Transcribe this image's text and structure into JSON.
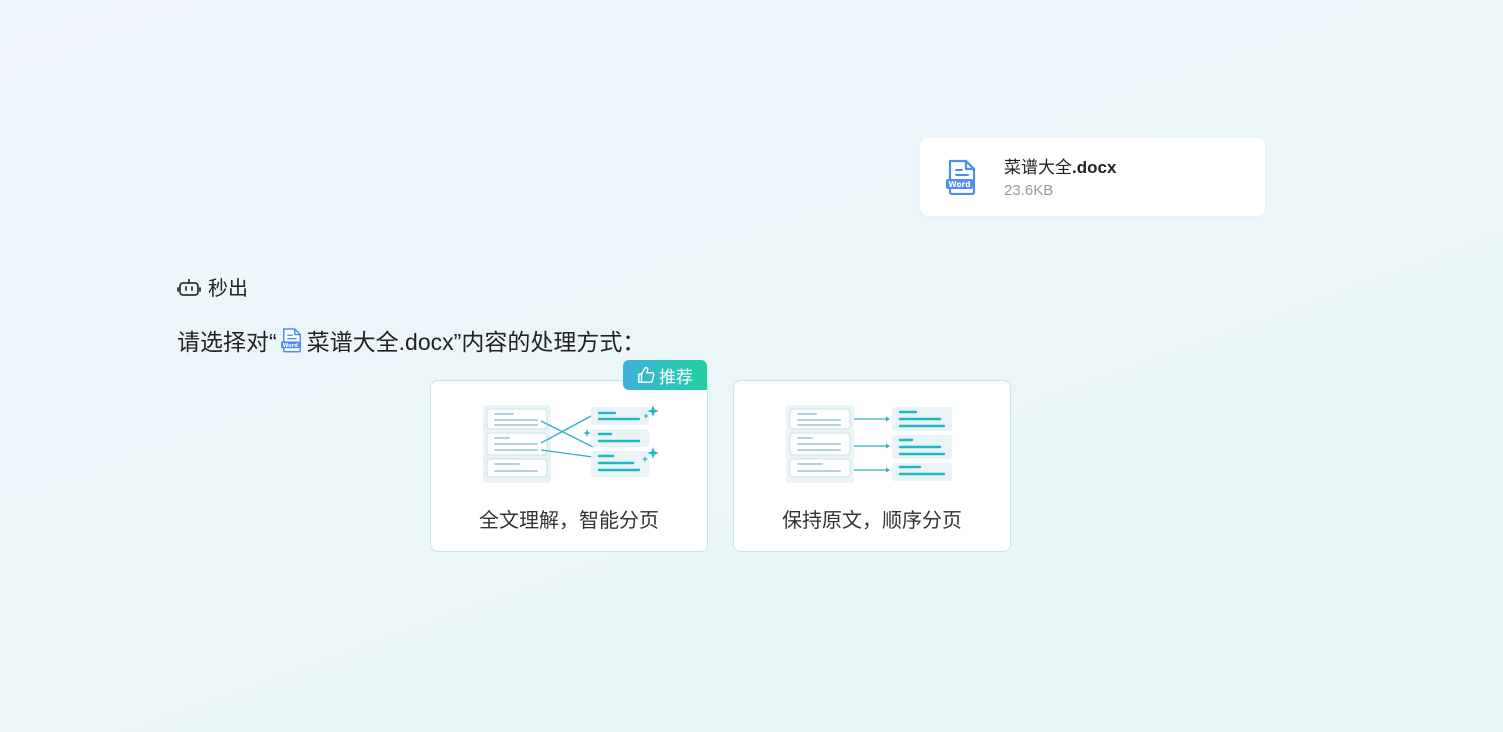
{
  "attachment": {
    "name": "菜谱大全",
    "ext": ".docx",
    "size": "23.6KB",
    "icon": "word-file-icon"
  },
  "assistant": {
    "name": "秒出",
    "icon": "robot-icon"
  },
  "prompt": {
    "prefix": "请选择对“",
    "file_name": "菜谱大全.docx",
    "suffix": "”内容的处理方式："
  },
  "options": [
    {
      "label": "全文理解，智能分页",
      "badge": "推荐",
      "recommended": true,
      "illustration": "smart-split-illustration"
    },
    {
      "label": "保持原文，顺序分页",
      "recommended": false,
      "illustration": "sequential-split-illustration"
    }
  ],
  "colors": {
    "accent_teal": "#1fb7c4",
    "badge_gradient_start": "#3fb1dc",
    "badge_gradient_end": "#22cfa1",
    "word_blue": "#4d8ef0"
  }
}
